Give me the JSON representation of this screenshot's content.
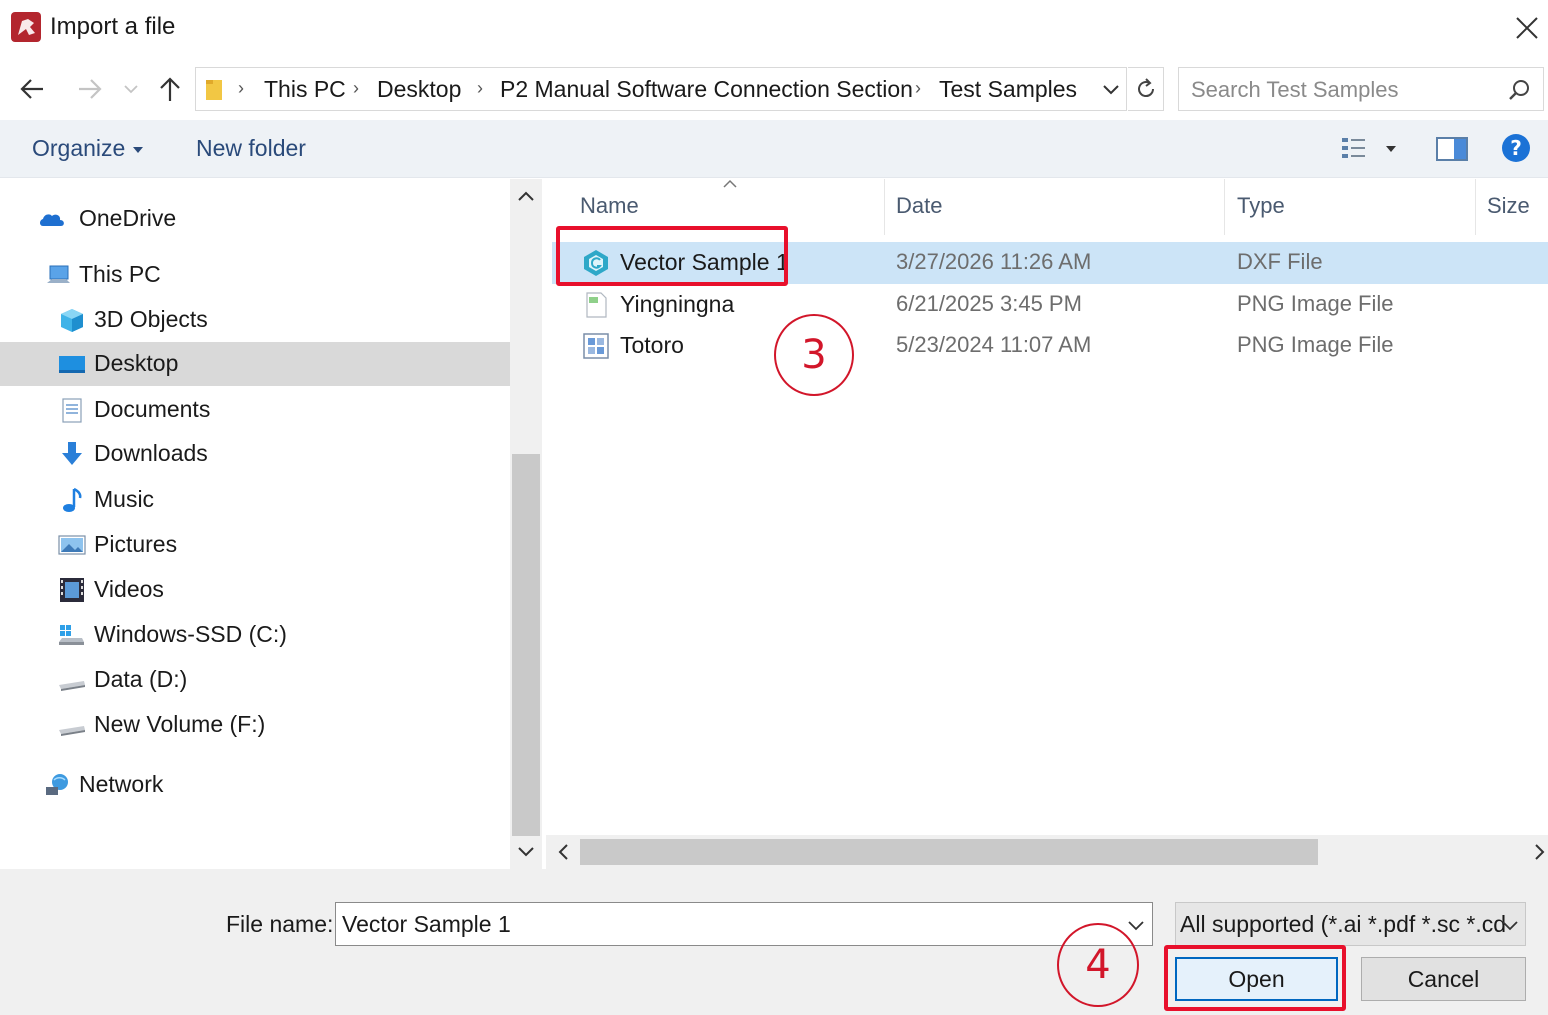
{
  "window": {
    "title": "Import a file"
  },
  "address_bar": {
    "crumbs": [
      "This PC",
      "Desktop",
      "P2 Manual Software Connection Section",
      "Test Samples"
    ]
  },
  "search": {
    "placeholder": "Search Test Samples"
  },
  "toolbar": {
    "organize_label": "Organize",
    "new_folder_label": "New folder"
  },
  "nav_pane": {
    "items": [
      {
        "label": "OneDrive",
        "icon": "onedrive-icon"
      },
      {
        "label": "This PC",
        "icon": "computer-icon"
      },
      {
        "label": "3D Objects",
        "icon": "3d-objects-icon"
      },
      {
        "label": "Desktop",
        "icon": "desktop-icon",
        "selected": true
      },
      {
        "label": "Documents",
        "icon": "documents-icon"
      },
      {
        "label": "Downloads",
        "icon": "downloads-icon"
      },
      {
        "label": "Music",
        "icon": "music-icon"
      },
      {
        "label": "Pictures",
        "icon": "pictures-icon"
      },
      {
        "label": "Videos",
        "icon": "videos-icon"
      },
      {
        "label": "Windows-SSD (C:)",
        "icon": "drive-icon"
      },
      {
        "label": "Data (D:)",
        "icon": "drive-icon"
      },
      {
        "label": "New Volume (F:)",
        "icon": "drive-icon"
      },
      {
        "label": "Network",
        "icon": "network-icon"
      }
    ]
  },
  "file_list": {
    "columns": [
      "Name",
      "Date",
      "Type",
      "Size"
    ],
    "rows": [
      {
        "name": "Vector Sample 1",
        "date": "3/27/2026 11:26 AM",
        "type": "DXF File",
        "selected": true,
        "icon": "dxf-file-icon"
      },
      {
        "name": "Yingningna",
        "date": "6/21/2025 3:45 PM",
        "type": "PNG Image File",
        "icon": "png-file-icon"
      },
      {
        "name": "Totoro",
        "date": "5/23/2024 11:07 AM",
        "type": "PNG Image File",
        "icon": "png-file-icon"
      }
    ]
  },
  "footer": {
    "file_name_label": "File name:",
    "file_name_value": "Vector Sample 1",
    "filter_value": "All supported (*.ai *.pdf *.sc *.cd",
    "open_label": "Open",
    "cancel_label": "Cancel"
  },
  "annotations": {
    "step3": "3",
    "step4": "4",
    "color": "#e8102c"
  },
  "colors": {
    "selection": "#cce4f7",
    "accent": "#0067c0"
  }
}
